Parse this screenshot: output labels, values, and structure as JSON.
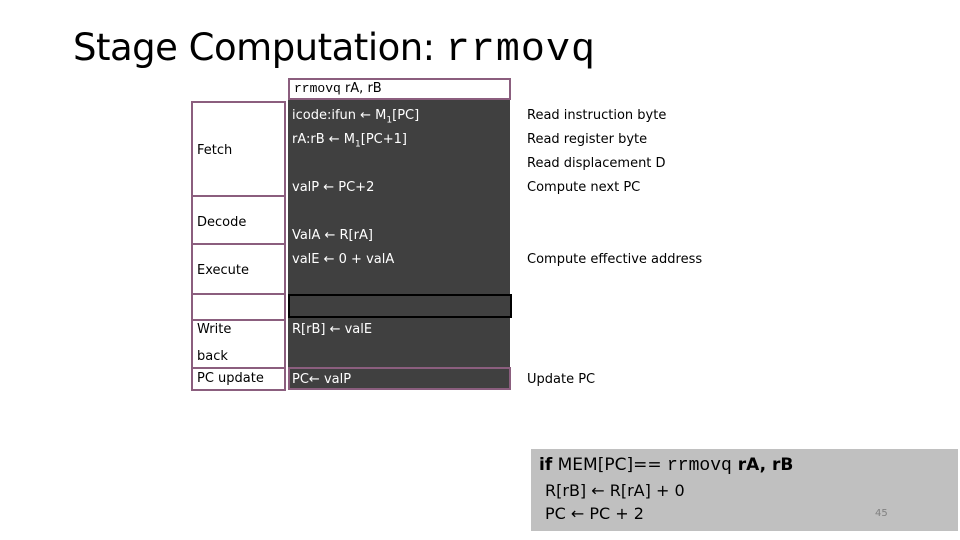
{
  "title": {
    "text": "Stage Computation: ",
    "mono": "rrmovq"
  },
  "header": {
    "mono": "rrmovq",
    "text": " rA, rB"
  },
  "stages": {
    "fetch": "Fetch",
    "decode": "Decode",
    "execute": "Execute",
    "memory": "",
    "write1": "Write",
    "write2": "back",
    "pc_update": "PC update"
  },
  "computations": {
    "fetch1_pre": "icode:ifun ← M",
    "fetch1_sub": "1",
    "fetch1_post": "[PC]",
    "fetch2_pre": "rA:rB ← M",
    "fetch2_sub": "1",
    "fetch2_post": "[PC+1]",
    "fetch3": "valP ← PC+2",
    "decode": "ValA ← R[rA]",
    "execute": "valE ← 0 + valA",
    "writeback": "R[rB] ← valE",
    "pc_update": "PC← valP"
  },
  "notes": {
    "n1": "Read instruction byte",
    "n2": "Read register byte",
    "n3": "Read displacement D",
    "n4": "Compute next PC",
    "n5": "Compute effective address",
    "n6": "Update PC"
  },
  "summary": {
    "if_kw": "if",
    "mem": " MEM[PC]== ",
    "mono": "rrmovq",
    "args": " rA, rB",
    "line2": "R[rB] ← R[rA] + 0",
    "line3": "PC ← PC + 2"
  },
  "page_number": "45"
}
